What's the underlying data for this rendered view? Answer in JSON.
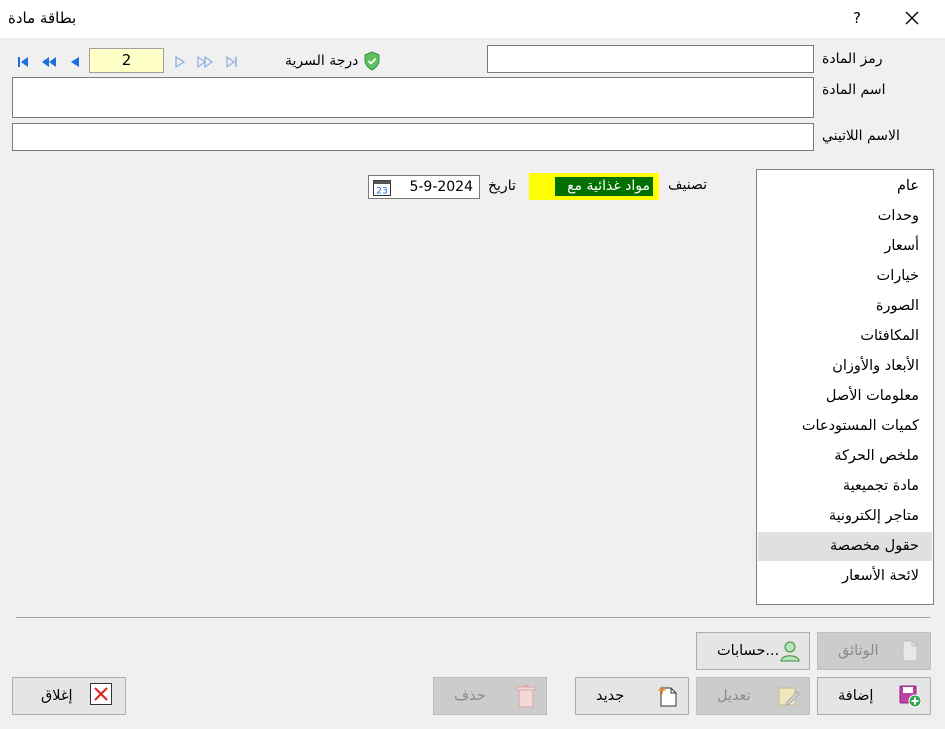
{
  "window": {
    "title": "بطاقة مادة",
    "help_label": "?"
  },
  "navigator": {
    "page_number": "2"
  },
  "security": {
    "label": "درجة السرية"
  },
  "fields": {
    "code_label": "رمز المادة",
    "code_value": "",
    "name_label": "اسم المادة",
    "name_value": "",
    "latin_label": "الاسم اللاتيني",
    "latin_value": ""
  },
  "general": {
    "classification_label": "تصنيف",
    "classification_value": "مواد غذائية مع",
    "date_label": "تاريخ",
    "date_value": "5-9-2024",
    "calendar_day": "23"
  },
  "sidebar": {
    "items": [
      {
        "label": "عام"
      },
      {
        "label": "وحدات"
      },
      {
        "label": "أسعار"
      },
      {
        "label": "خيارات"
      },
      {
        "label": "الصورة"
      },
      {
        "label": "المكافئات"
      },
      {
        "label": "الأبعاد والأوزان"
      },
      {
        "label": "معلومات الأصل"
      },
      {
        "label": "كميات المستودعات"
      },
      {
        "label": "ملخص الحركة"
      },
      {
        "label": "مادة تجميعية"
      },
      {
        "label": "متاجر إلكترونية"
      },
      {
        "label": "حقول مخصصة"
      },
      {
        "label": "لائحة الأسعار"
      }
    ],
    "active_index": 12
  },
  "buttons": {
    "documents": "الوثائق",
    "accounts": "حسابات...",
    "add": "إضافة",
    "edit": "تعديل",
    "new": "جديد",
    "delete": "حذف",
    "close": "إغلاق"
  },
  "colors": {
    "highlight": "#ffff00",
    "selection": "#007000",
    "page_box": "#ffffc8",
    "nav_blue": "#1e6fd9"
  }
}
